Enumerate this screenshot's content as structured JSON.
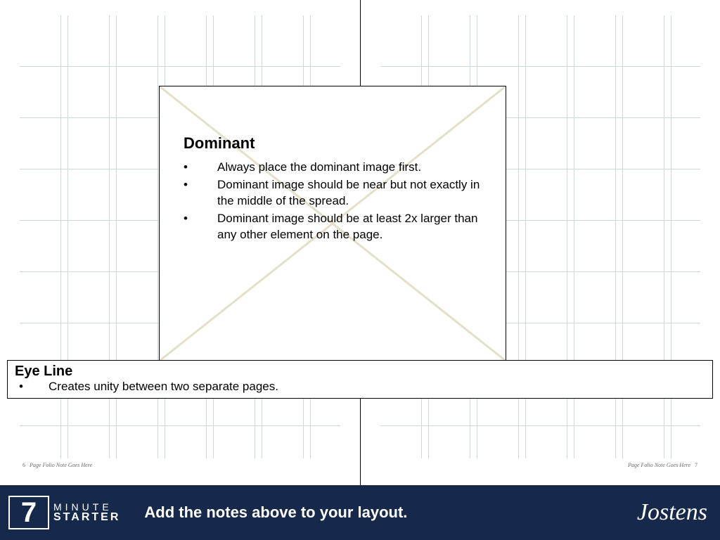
{
  "spread": {
    "left_page_number": "6",
    "right_page_number": "7",
    "folio_note": "Page Folio Note Goes Here"
  },
  "dominant": {
    "heading": "Dominant",
    "bullets": [
      "Always place the dominant image first.",
      "Dominant image should be near but not exactly in the middle of the spread.",
      "Dominant image should be at least 2x larger than any other element on the page."
    ]
  },
  "eyeline": {
    "heading": "Eye Line",
    "bullet": "Creates unity between two separate pages."
  },
  "footer": {
    "logo_top": "MINUTE",
    "logo_bottom": "STARTER",
    "logo_number": "7",
    "instruction": "Add the notes above to your layout.",
    "brand": "Jostens"
  }
}
